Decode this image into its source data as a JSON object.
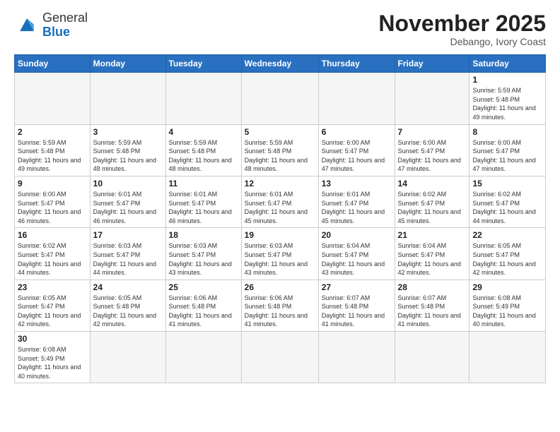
{
  "logo": {
    "text_general": "General",
    "text_blue": "Blue"
  },
  "header": {
    "month_year": "November 2025",
    "location": "Debango, Ivory Coast"
  },
  "weekdays": [
    "Sunday",
    "Monday",
    "Tuesday",
    "Wednesday",
    "Thursday",
    "Friday",
    "Saturday"
  ],
  "weeks": [
    [
      {
        "day": "",
        "empty": true
      },
      {
        "day": "",
        "empty": true
      },
      {
        "day": "",
        "empty": true
      },
      {
        "day": "",
        "empty": true
      },
      {
        "day": "",
        "empty": true
      },
      {
        "day": "",
        "empty": true
      },
      {
        "day": "1",
        "sunrise": "5:59 AM",
        "sunset": "5:48 PM",
        "daylight": "11 hours and 49 minutes."
      }
    ],
    [
      {
        "day": "2",
        "sunrise": "5:59 AM",
        "sunset": "5:48 PM",
        "daylight": "11 hours and 49 minutes."
      },
      {
        "day": "3",
        "sunrise": "5:59 AM",
        "sunset": "5:48 PM",
        "daylight": "11 hours and 48 minutes."
      },
      {
        "day": "4",
        "sunrise": "5:59 AM",
        "sunset": "5:48 PM",
        "daylight": "11 hours and 48 minutes."
      },
      {
        "day": "5",
        "sunrise": "5:59 AM",
        "sunset": "5:48 PM",
        "daylight": "11 hours and 48 minutes."
      },
      {
        "day": "6",
        "sunrise": "6:00 AM",
        "sunset": "5:47 PM",
        "daylight": "11 hours and 47 minutes."
      },
      {
        "day": "7",
        "sunrise": "6:00 AM",
        "sunset": "5:47 PM",
        "daylight": "11 hours and 47 minutes."
      },
      {
        "day": "8",
        "sunrise": "6:00 AM",
        "sunset": "5:47 PM",
        "daylight": "11 hours and 47 minutes."
      }
    ],
    [
      {
        "day": "9",
        "sunrise": "6:00 AM",
        "sunset": "5:47 PM",
        "daylight": "11 hours and 46 minutes."
      },
      {
        "day": "10",
        "sunrise": "6:01 AM",
        "sunset": "5:47 PM",
        "daylight": "11 hours and 46 minutes."
      },
      {
        "day": "11",
        "sunrise": "6:01 AM",
        "sunset": "5:47 PM",
        "daylight": "11 hours and 46 minutes."
      },
      {
        "day": "12",
        "sunrise": "6:01 AM",
        "sunset": "5:47 PM",
        "daylight": "11 hours and 45 minutes."
      },
      {
        "day": "13",
        "sunrise": "6:01 AM",
        "sunset": "5:47 PM",
        "daylight": "11 hours and 45 minutes."
      },
      {
        "day": "14",
        "sunrise": "6:02 AM",
        "sunset": "5:47 PM",
        "daylight": "11 hours and 45 minutes."
      },
      {
        "day": "15",
        "sunrise": "6:02 AM",
        "sunset": "5:47 PM",
        "daylight": "11 hours and 44 minutes."
      }
    ],
    [
      {
        "day": "16",
        "sunrise": "6:02 AM",
        "sunset": "5:47 PM",
        "daylight": "11 hours and 44 minutes."
      },
      {
        "day": "17",
        "sunrise": "6:03 AM",
        "sunset": "5:47 PM",
        "daylight": "11 hours and 44 minutes."
      },
      {
        "day": "18",
        "sunrise": "6:03 AM",
        "sunset": "5:47 PM",
        "daylight": "11 hours and 43 minutes."
      },
      {
        "day": "19",
        "sunrise": "6:03 AM",
        "sunset": "5:47 PM",
        "daylight": "11 hours and 43 minutes."
      },
      {
        "day": "20",
        "sunrise": "6:04 AM",
        "sunset": "5:47 PM",
        "daylight": "11 hours and 43 minutes."
      },
      {
        "day": "21",
        "sunrise": "6:04 AM",
        "sunset": "5:47 PM",
        "daylight": "11 hours and 42 minutes."
      },
      {
        "day": "22",
        "sunrise": "6:05 AM",
        "sunset": "5:47 PM",
        "daylight": "11 hours and 42 minutes."
      }
    ],
    [
      {
        "day": "23",
        "sunrise": "6:05 AM",
        "sunset": "5:47 PM",
        "daylight": "11 hours and 42 minutes."
      },
      {
        "day": "24",
        "sunrise": "6:05 AM",
        "sunset": "5:48 PM",
        "daylight": "11 hours and 42 minutes."
      },
      {
        "day": "25",
        "sunrise": "6:06 AM",
        "sunset": "5:48 PM",
        "daylight": "11 hours and 41 minutes."
      },
      {
        "day": "26",
        "sunrise": "6:06 AM",
        "sunset": "5:48 PM",
        "daylight": "11 hours and 41 minutes."
      },
      {
        "day": "27",
        "sunrise": "6:07 AM",
        "sunset": "5:48 PM",
        "daylight": "11 hours and 41 minutes."
      },
      {
        "day": "28",
        "sunrise": "6:07 AM",
        "sunset": "5:48 PM",
        "daylight": "11 hours and 41 minutes."
      },
      {
        "day": "29",
        "sunrise": "6:08 AM",
        "sunset": "5:49 PM",
        "daylight": "11 hours and 40 minutes."
      }
    ],
    [
      {
        "day": "30",
        "sunrise": "6:08 AM",
        "sunset": "5:49 PM",
        "daylight": "11 hours and 40 minutes."
      },
      {
        "day": "",
        "empty": true
      },
      {
        "day": "",
        "empty": true
      },
      {
        "day": "",
        "empty": true
      },
      {
        "day": "",
        "empty": true
      },
      {
        "day": "",
        "empty": true
      },
      {
        "day": "",
        "empty": true
      }
    ]
  ],
  "labels": {
    "sunrise": "Sunrise:",
    "sunset": "Sunset:",
    "daylight": "Daylight:"
  }
}
